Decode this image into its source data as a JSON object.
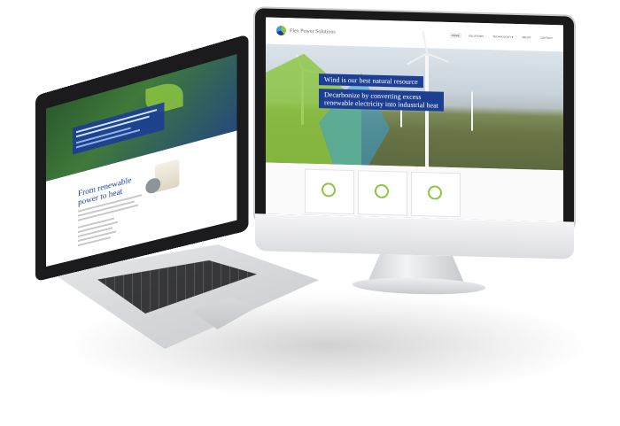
{
  "desktop_site": {
    "logo_text": "Flex Power Solutions",
    "nav": [
      "HOME",
      "SOLUTIONS",
      "TECHNOLOGY ▾",
      "ABOUT",
      "CONTACT"
    ],
    "hero_line1": "Wind is our best natural resource",
    "hero_line2a": "Decarbonize by converting excess",
    "hero_line2b": "renewable electricity into industrial heat",
    "cards": [
      "card-1",
      "card-2",
      "card-3"
    ]
  },
  "laptop_site": {
    "title_line1": "From renewable",
    "title_line2": "power to heat"
  },
  "colors": {
    "brand_blue": "#1c3f94",
    "brand_green": "#8cc63f",
    "accent_blue": "#3aa0d8"
  }
}
